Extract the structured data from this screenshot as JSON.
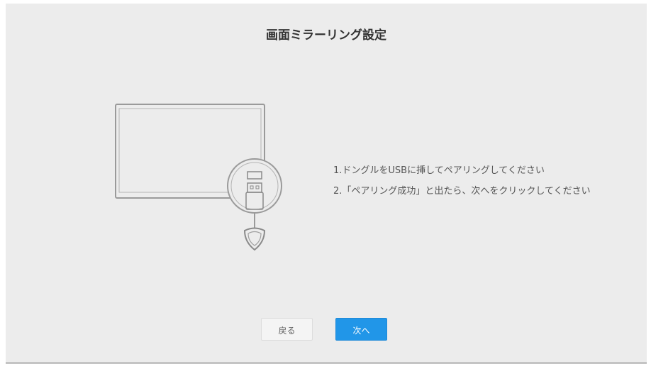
{
  "dialog": {
    "title": "画面ミラーリング設定",
    "steps": [
      "1.ドングルをUSBに挿してペアリングしてください",
      "2.「ペアリング成功」と出たら、次へをクリックしてください"
    ],
    "back_label": "戻る",
    "next_label": "次へ"
  },
  "colors": {
    "primary_button": "#2196e8",
    "background": "#ececec"
  },
  "icons": {
    "illustration": "display-with-usb-dongle"
  }
}
